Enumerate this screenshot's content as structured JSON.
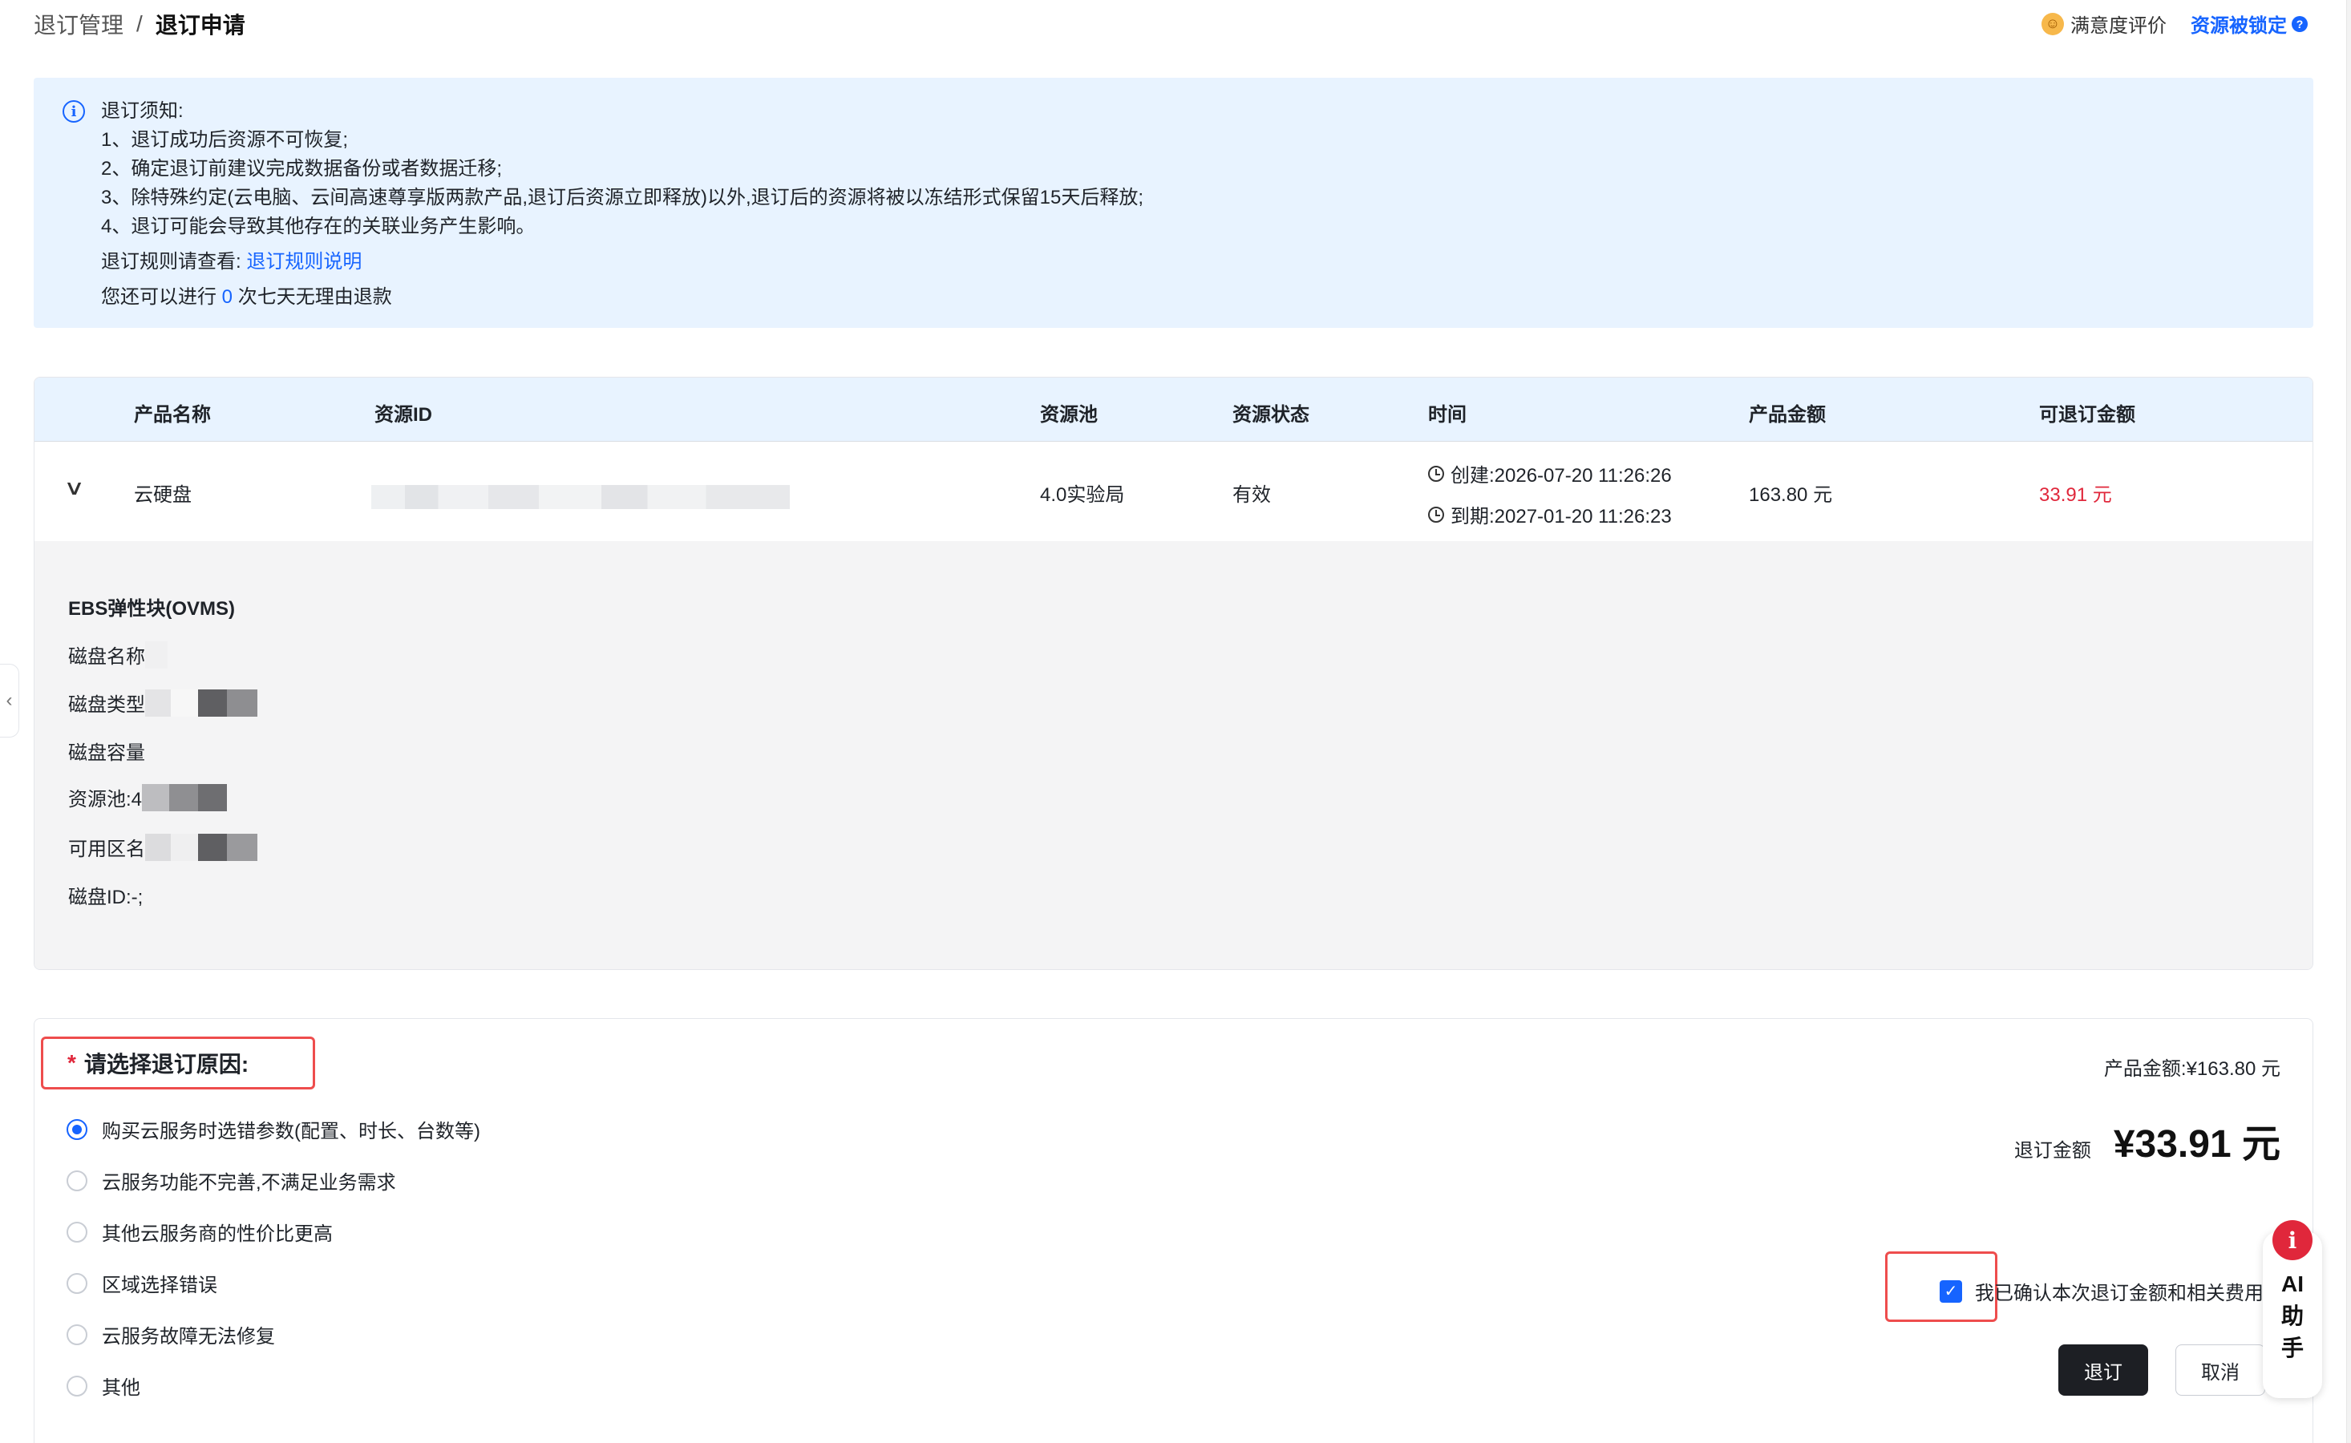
{
  "breadcrumb": {
    "parent": "退订管理",
    "separator": "/",
    "current": "退订申请"
  },
  "header": {
    "satisfaction": "满意度评价",
    "resource_locked": "资源被锁定"
  },
  "notice": {
    "title": "退订须知:",
    "items": [
      "1、退订成功后资源不可恢复;",
      "2、确定退订前建议完成数据备份或者数据迁移;",
      "3、除特殊约定(云电脑、云间高速尊享版两款产品,退订后资源立即释放)以外,退订后的资源将被以冻结形式保留15天后释放;",
      "4、退订可能会导致其他存在的关联业务产生影响。"
    ],
    "rule_prefix": "退订规则请查看:",
    "rule_link": "退订规则说明",
    "refund_prefix": "您还可以进行",
    "refund_count": "0",
    "refund_suffix": "次七天无理由退款"
  },
  "table": {
    "columns": [
      "产品名称",
      "资源ID",
      "资源池",
      "资源状态",
      "时间",
      "产品金额",
      "可退订金额"
    ],
    "row": {
      "product": "云硬盘",
      "pool": "4.0实验局",
      "status": "有效",
      "created": "创建:2026-07-20 11:26:26",
      "expires": "到期:2027-01-20 11:26:23",
      "amount": "163.80 元",
      "refundable": "33.91 元"
    },
    "detail": {
      "title": "EBS弹性块(OVMS)",
      "disk_name": "磁盘名称",
      "disk_type": "磁盘类型",
      "disk_capacity": "磁盘容量",
      "pool": "资源池:4",
      "zone": "可用区名",
      "disk_id": "磁盘ID:-;"
    }
  },
  "reason": {
    "required_mark": "*",
    "title": "请选择退订原因:",
    "options": [
      "购买云服务时选错参数(配置、时长、台数等)",
      "云服务功能不完善,不满足业务需求",
      "其他云服务商的性价比更高",
      "区域选择错误",
      "云服务故障无法修复",
      "其他"
    ],
    "selected_index": 0,
    "product_amount": "产品金额:¥163.80 元",
    "refund_label": "退订金额",
    "refund_value": "¥33.91 元",
    "confirm_text": "我已确认本次退订金额和相关费用",
    "confirm_checked": true,
    "submit": "退订",
    "cancel": "取消"
  },
  "assistant": {
    "label": "AI助手",
    "icon": "i"
  },
  "colors": {
    "accent": "#1664ff",
    "danger": "#e0273b",
    "notice_bg": "#e8f3ff",
    "primary_btn": "#1d1f24"
  }
}
